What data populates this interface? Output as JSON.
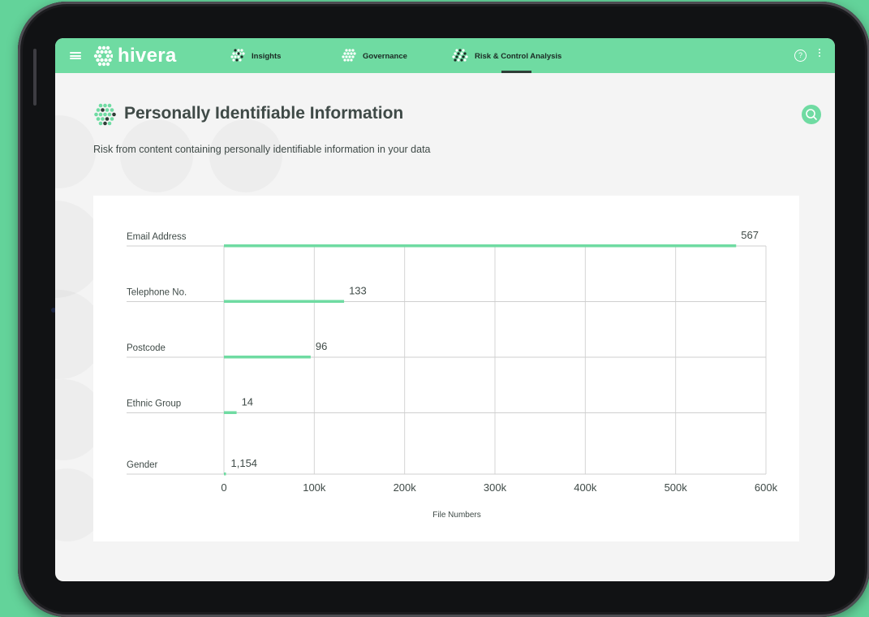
{
  "app": {
    "name": "hivera"
  },
  "nav": {
    "tabs": [
      {
        "label": "Insights",
        "active": false
      },
      {
        "label": "Governance",
        "active": false
      },
      {
        "label": "Risk & Control Analysis",
        "active": true
      }
    ],
    "icons": [
      "hamburger-menu-icon",
      "hexagon-dots-logo-icon",
      "help-icon",
      "more-vertical-icon"
    ]
  },
  "page": {
    "title": "Personally Identifiable Information",
    "subtitle": "Risk from content containing personally identifiable information in your data"
  },
  "colors": {
    "accent": "#6fdba2",
    "background": "#63d39a",
    "text": "#3f4a47"
  },
  "chart_data": {
    "type": "bar",
    "orientation": "horizontal",
    "categories": [
      "Email Address",
      "Telephone No.",
      "Postcode",
      "Ethnic Group",
      "Gender"
    ],
    "values": [
      567000,
      133000,
      96000,
      14000,
      1154
    ],
    "data_labels": [
      "567",
      "133",
      "96",
      "14",
      "1,154"
    ],
    "xlabel": "File Numbers",
    "ylabel": "",
    "xlim": [
      0,
      600000
    ],
    "ticks": [
      0,
      100000,
      200000,
      300000,
      400000,
      500000,
      600000
    ],
    "tick_labels": [
      "0",
      "100k",
      "200k",
      "300k",
      "400k",
      "500k",
      "600k"
    ],
    "grid": true,
    "bar_color": "#6fdba2"
  }
}
